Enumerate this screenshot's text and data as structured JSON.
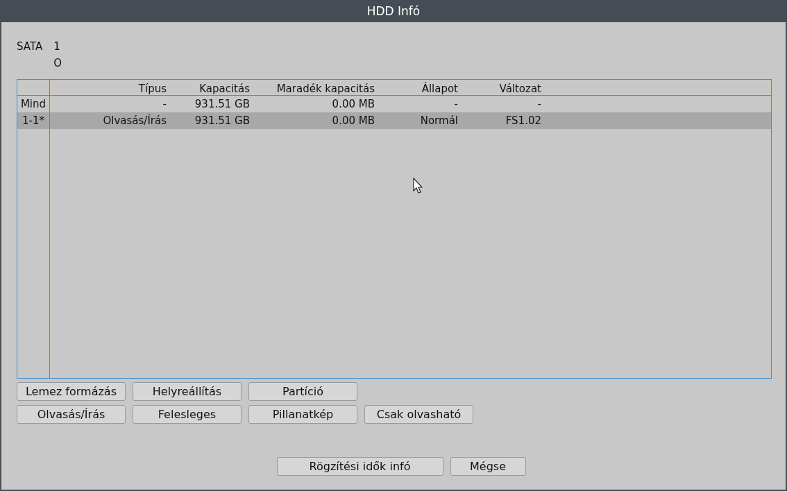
{
  "window": {
    "title": "HDD Infó"
  },
  "sata": {
    "label": "SATA",
    "ports": [
      {
        "number": "1",
        "status": "O"
      }
    ]
  },
  "table": {
    "columns": [
      "Típus",
      "Kapacitás",
      "Maradék kapacitás",
      "Állapot",
      "Változat"
    ],
    "rows": [
      {
        "id": "Mind",
        "cells": [
          "-",
          "931.51 GB",
          "0.00 MB",
          "-",
          "-"
        ],
        "selected": false
      },
      {
        "id": "1-1*",
        "cells": [
          "Olvasás/Írás",
          "931.51 GB",
          "0.00 MB",
          "Normál",
          "FS1.02"
        ],
        "selected": true
      }
    ]
  },
  "action_buttons": [
    [
      "Lemez formázás",
      "Helyreállítás",
      "Partíció"
    ],
    [
      "Olvasás/Írás",
      "Felesleges",
      "Pillanatkép",
      "Csak olvasható"
    ]
  ],
  "footer_buttons": [
    "Rögzítési idők infó",
    "Mégse"
  ]
}
